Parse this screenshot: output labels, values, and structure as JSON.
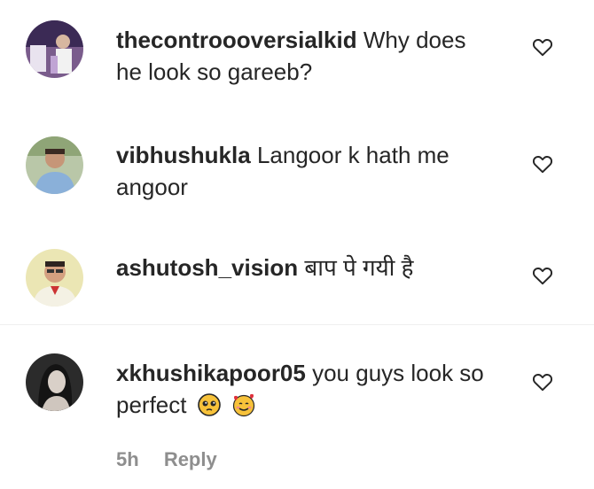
{
  "comments": [
    {
      "username": "thecontroooversialkid",
      "text": "Why does he look so gareeb?",
      "avatar_icon": "user-avatar-photo-icon"
    },
    {
      "username": "vibhushukla",
      "text": "Langoor k hath me angoor",
      "avatar_icon": "user-avatar-photo-icon"
    },
    {
      "username": "ashutosh_vision",
      "text": "बाप पे गयी है",
      "avatar_icon": "user-avatar-photo-icon"
    },
    {
      "username": "xkhushikapoor05",
      "text": "you guys look so perfect",
      "emojis": [
        "pleading-face-emoji",
        "smiling-face-with-hearts-emoji"
      ],
      "time": "5h",
      "reply_label": "Reply",
      "avatar_icon": "user-avatar-photo-icon"
    }
  ],
  "icons": {
    "like": "heart-outline-icon"
  },
  "colors": {
    "text": "#262626",
    "muted": "#8e8e8e",
    "divider": "#efefef"
  }
}
